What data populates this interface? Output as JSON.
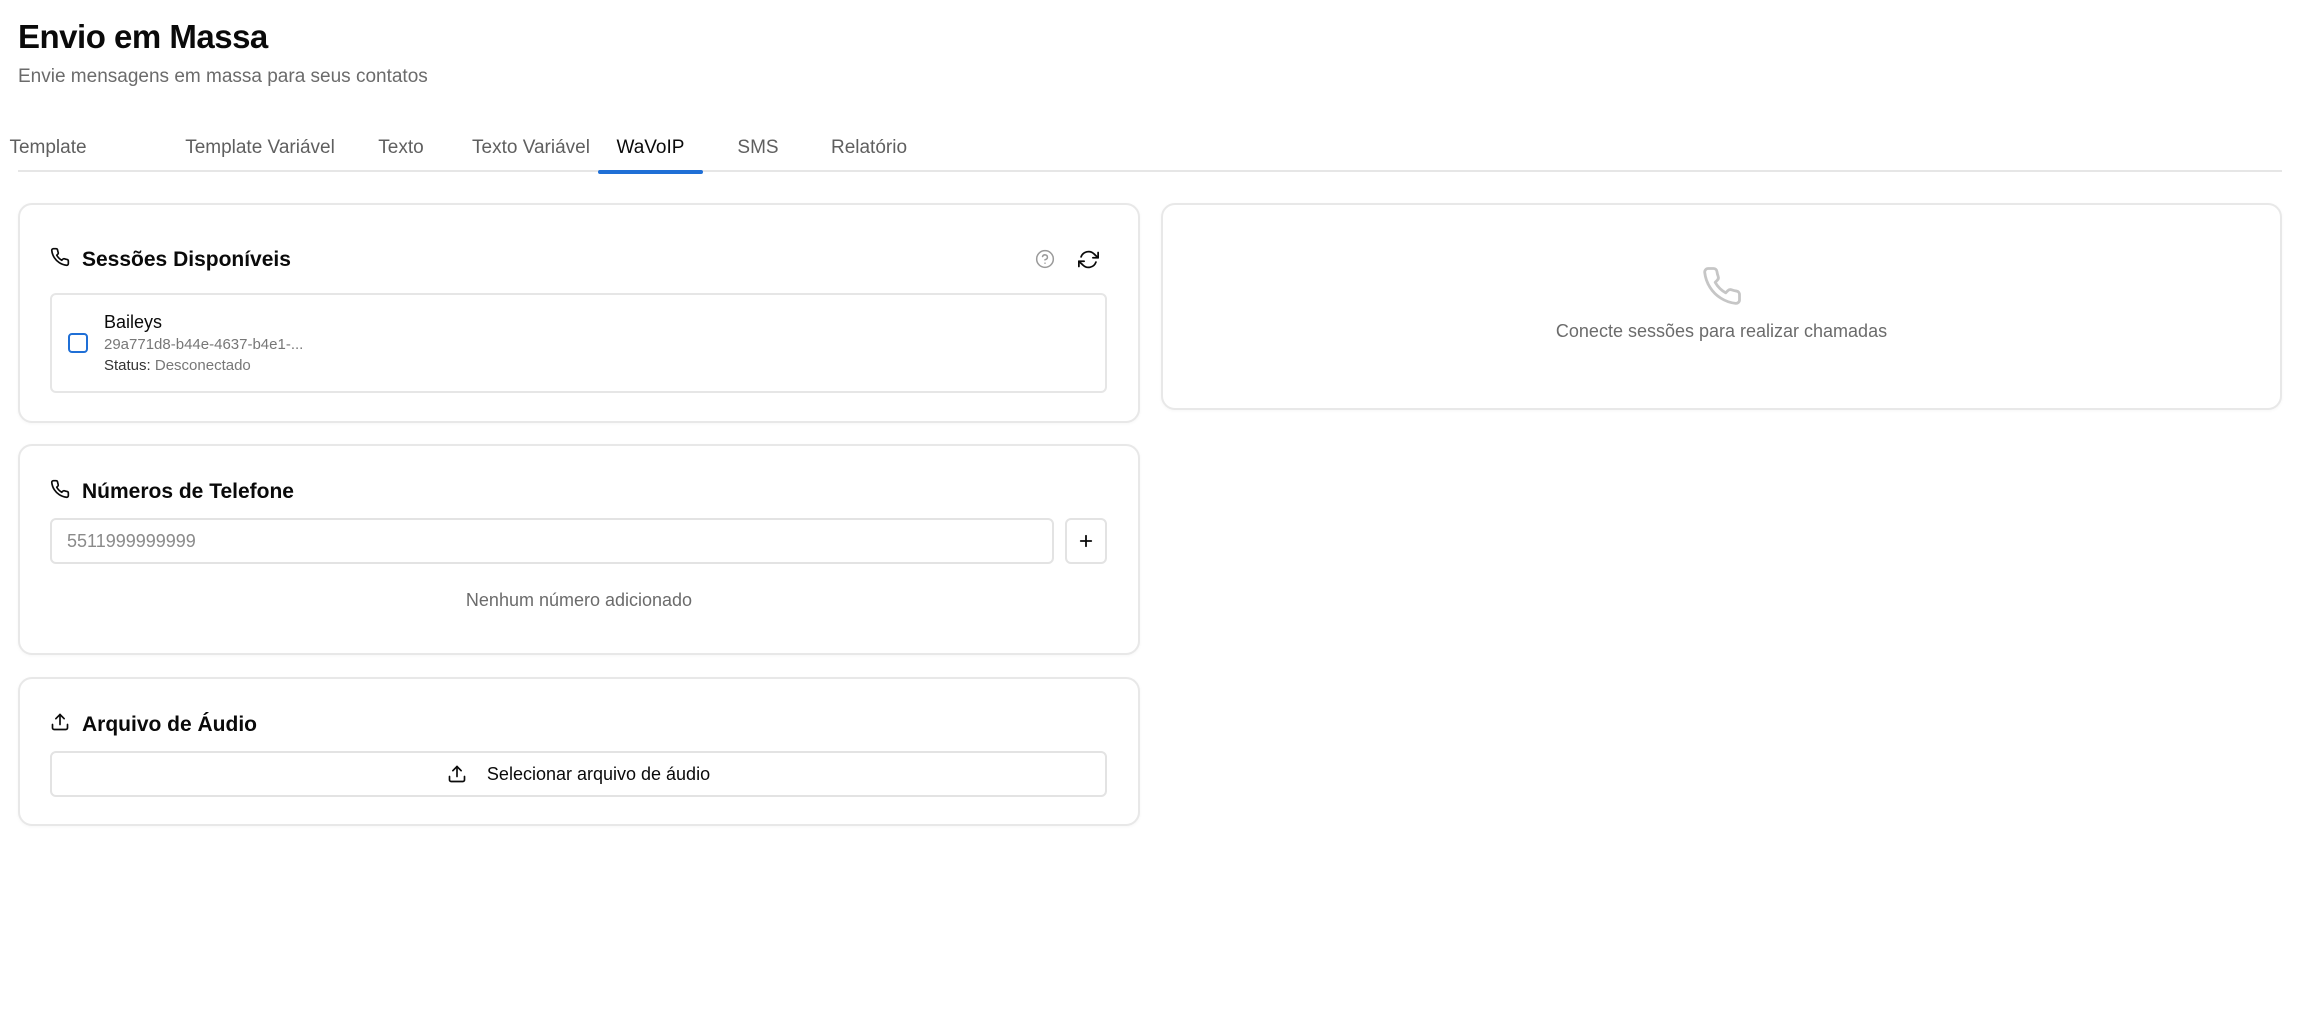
{
  "page": {
    "title": "Envio em Massa",
    "subtitle": "Envie mensagens em massa para seus contatos"
  },
  "tabs": [
    {
      "label": "Template",
      "active": false
    },
    {
      "label": "Template Variável",
      "active": false
    },
    {
      "label": "Texto",
      "active": false
    },
    {
      "label": "Texto Variável",
      "active": false
    },
    {
      "label": "WaVoIP",
      "active": true
    },
    {
      "label": "SMS",
      "active": false
    },
    {
      "label": "Relatório",
      "active": false
    }
  ],
  "sessions": {
    "title": "Sessões Disponíveis",
    "title_icon": "phone-icon",
    "help_icon": "help-circle-icon",
    "refresh_icon": "refresh-icon",
    "items": [
      {
        "name": "Baileys",
        "id": "29a771d8-b44e-4637-b4e1-...",
        "status_label": "Status:",
        "status_value": "Desconectado",
        "checked": false
      }
    ]
  },
  "phones": {
    "title": "Números de Telefone",
    "title_icon": "phone-icon",
    "input_value": "",
    "input_placeholder": "5511999999999",
    "add_icon": "plus-icon",
    "empty_message": "Nenhum número adicionado"
  },
  "audio": {
    "title": "Arquivo de Áudio",
    "title_icon": "upload-icon",
    "button_label": "Selecionar arquivo de áudio",
    "button_icon": "upload-icon"
  },
  "calls": {
    "icon": "phone-icon",
    "empty_message": "Conecte sessões para realizar chamadas"
  },
  "colors": {
    "accent": "#1f6fd6",
    "muted_text": "#6b6b6b",
    "border": "#e6e6e6"
  }
}
